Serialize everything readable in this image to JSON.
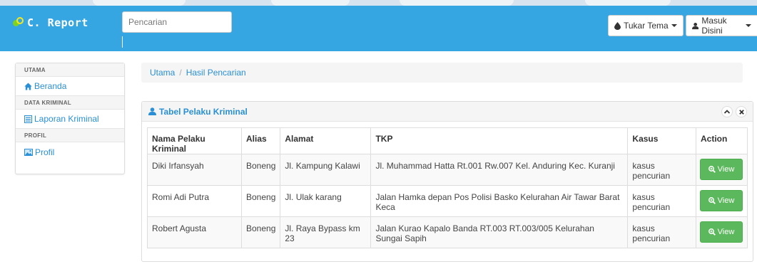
{
  "app": {
    "brand": "C. Report"
  },
  "navbar": {
    "search_placeholder": "Pencarian",
    "theme_button": "Tukar Tema",
    "login_button": "Masuk Disini"
  },
  "sidebar": {
    "sections": [
      {
        "heading": "UTAMA",
        "items": [
          {
            "label": "Beranda",
            "icon": "home-icon"
          }
        ]
      },
      {
        "heading": "DATA KRIMINAL",
        "items": [
          {
            "label": "Laporan Kriminal",
            "icon": "list-icon"
          }
        ]
      },
      {
        "heading": "PROFIL",
        "items": [
          {
            "label": "Profil",
            "icon": "picture-icon"
          }
        ]
      }
    ]
  },
  "breadcrumb": {
    "items": [
      "Utama",
      "Hasil Pencarian"
    ]
  },
  "panel": {
    "title": "Tabel Pelaku Kriminal",
    "columns": [
      "Nama Pelaku Kriminal",
      "Alias",
      "Alamat",
      "TKP",
      "Kasus",
      "Action"
    ],
    "rows": [
      {
        "nama": "Diki Irfansyah",
        "alias": "Boneng",
        "alamat": "Jl. Kampung Kalawi",
        "tkp": "Jl. Muhammad Hatta Rt.001 Rw.007 Kel. Anduring Kec. Kuranji",
        "kasus": "kasus pencurian",
        "action": "View"
      },
      {
        "nama": "Romi Adi Putra",
        "alias": "Boneng",
        "alamat": "Jl. Ulak karang",
        "tkp": "Jalan Hamka depan Pos Polisi Basko Kelurahan Air Tawar Barat Keca",
        "kasus": "kasus pencurian",
        "action": "View"
      },
      {
        "nama": "Robert Agusta",
        "alias": "Boneng",
        "alamat": "Jl. Raya Bypass km 23",
        "tkp": "Jalan Kurao Kapalo Banda RT.003 RT.003/005 Kelurahan Sungai Sapih",
        "kasus": "kasus pencurian",
        "action": "View"
      }
    ]
  },
  "colors": {
    "navbar": "#35a6e2",
    "link": "#2a8fd4",
    "view_button": "#5cb85c"
  }
}
